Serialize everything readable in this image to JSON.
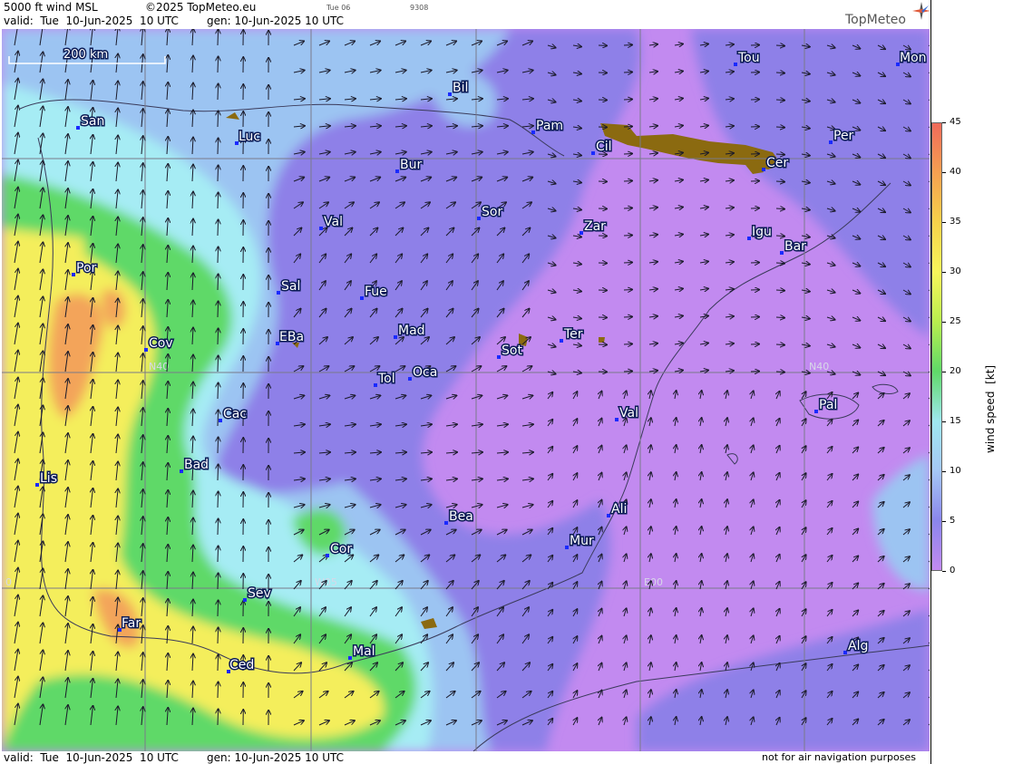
{
  "header": {
    "product": "5000 ft wind MSL",
    "copyright": "©2025 TopMeteo.eu",
    "day_short": "Tue 06",
    "code": "9308",
    "valid": "valid:  Tue  10-Jun-2025  10 UTC",
    "generated": "gen: 10-Jun-2025 10 UTC",
    "brand": "TopMeteo"
  },
  "footer": {
    "valid": "valid:  Tue  10-Jun-2025  10 UTC",
    "generated": "gen: 10-Jun-2025 10 UTC",
    "disclaimer": "not for air navigation purposes"
  },
  "scale_bar": {
    "label": "200 km"
  },
  "grid_labels": {
    "lat": "N40",
    "lon_w": "W05",
    "lon_e": "E00",
    "lon_w10": "0"
  },
  "cities": [
    "Bil",
    "Tou",
    "Mon",
    "San",
    "Luc",
    "Pam",
    "Cil",
    "Per",
    "Cer",
    "Bur",
    "Sor",
    "Val",
    "Zar",
    "Igu",
    "Bar",
    "Por",
    "Sal",
    "Fue",
    "Cov",
    "EBa",
    "Mad",
    "Ter",
    "Sot",
    "Tol",
    "Oca",
    "Pal",
    "Cac",
    "Val",
    "Bad",
    "Lis",
    "Ali",
    "Bea",
    "Mur",
    "Cor",
    "Sev",
    "Far",
    "Mal",
    "Ced",
    "Alg"
  ],
  "legend": {
    "title": "wind speed  [kt]",
    "ticks": [
      "45",
      "40",
      "35",
      "30",
      "25",
      "20",
      "15",
      "10",
      "5",
      "0"
    ],
    "colors": [
      "#f06a5a",
      "#f5a050",
      "#f6d24a",
      "#f7f55a",
      "#b9ee4e",
      "#5fd968",
      "#9fe8ef",
      "#a5c8f5",
      "#8a86ec",
      "#c28af0"
    ]
  },
  "colors": {
    "calm_purple": "#c28af0",
    "violet": "#8e80e8",
    "light_blue": "#9cc4f2",
    "cyan": "#a6ecf4",
    "green": "#5fd968",
    "yellow": "#f4ee5c",
    "orange": "#f3a45a",
    "terrain": "#8b6a10"
  }
}
